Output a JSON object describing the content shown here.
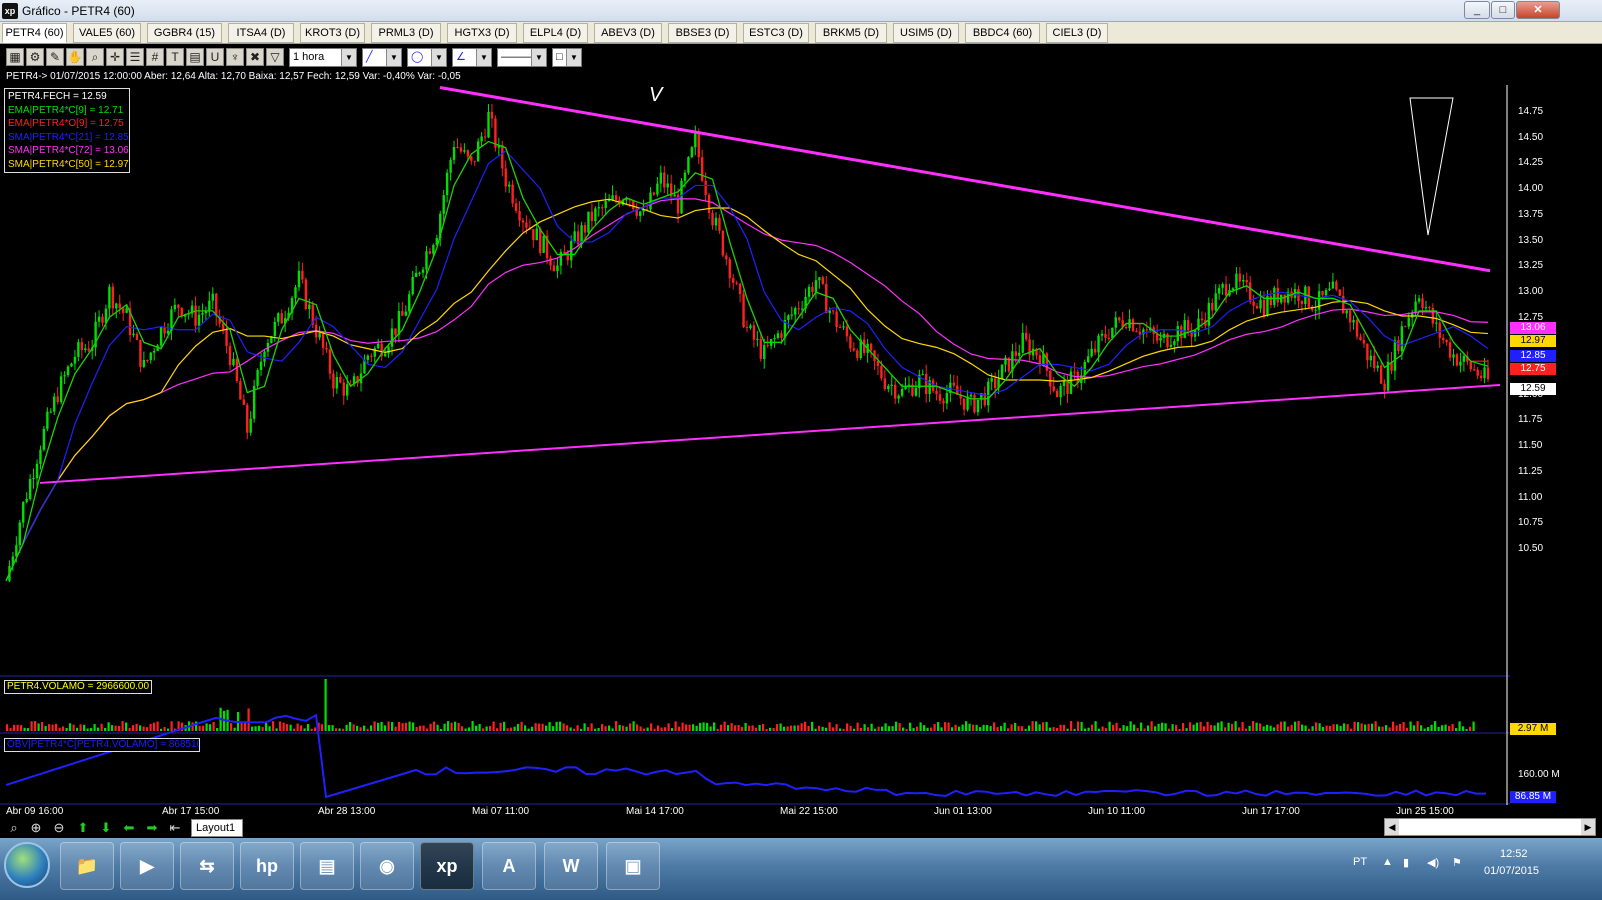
{
  "window": {
    "logo": "xp",
    "title": "Gráfico - PETR4 (60)",
    "minimize": "_",
    "maximize": "□",
    "close": "✕"
  },
  "tabs": [
    {
      "label": "PETR4 (60)",
      "active": true
    },
    {
      "label": "VALE5 (60)"
    },
    {
      "label": "GGBR4 (15)"
    },
    {
      "label": "ITSA4 (D)"
    },
    {
      "label": "KROT3 (D)"
    },
    {
      "label": "PRML3 (D)"
    },
    {
      "label": "HGTX3 (D)"
    },
    {
      "label": "ELPL4 (D)"
    },
    {
      "label": "ABEV3 (D)"
    },
    {
      "label": "BBSE3 (D)"
    },
    {
      "label": "ESTC3 (D)"
    },
    {
      "label": "BRKM5 (D)"
    },
    {
      "label": "USIM5 (D)"
    },
    {
      "label": "BBDC4 (60)"
    },
    {
      "label": "CIEL3 (D)"
    }
  ],
  "toolbar": {
    "icons": [
      "chart-type-icon",
      "settings-gear-icon",
      "draw-icon",
      "hand-pan-icon",
      "zoom-tool-icon",
      "crosshair-icon",
      "fibonacci-icon",
      "grid-icon",
      "text-tool-icon",
      "calculator-icon",
      "magnet-icon",
      "brush-icon",
      "trash-icon",
      "filter-icon"
    ],
    "periodicity": "1 hora"
  },
  "info_line": "PETR4-> 01/07/2015 12:00:00 Aber: 12,64 Alta: 12,70 Baixa: 12,57 Fech: 12,59 Var: -0,40% Var: -0,05",
  "legend": [
    {
      "text": "PETR4.FECH = 12.59",
      "color": "#ffffff"
    },
    {
      "text": "EMA|PETR4*C[9] = 12.71",
      "color": "#00e000"
    },
    {
      "text": "EMA|PETR4*O[9] = 12.75",
      "color": "#ff2020"
    },
    {
      "text": "SMA|PETR4*C[21] = 12.85",
      "color": "#2020ff"
    },
    {
      "text": "SMA|PETR4*C[72] = 13.06",
      "color": "#ff30ff"
    },
    {
      "text": "SMA|PETR4*C[50] = 12.97",
      "color": "#ffd800"
    }
  ],
  "price_axis": [
    "14.75",
    "14.50",
    "14.25",
    "14.00",
    "13.75",
    "13.50",
    "13.25",
    "13.00",
    "12.75",
    "12.50",
    "12.25",
    "12.00",
    "11.75",
    "11.50",
    "11.25",
    "11.00",
    "10.75",
    "10.50"
  ],
  "price_tags": [
    {
      "text": "13.06",
      "color": "#ff30ff",
      "fg": "#ffffff"
    },
    {
      "text": "12.97",
      "color": "#ffd800",
      "fg": "#000000"
    },
    {
      "text": "12.85",
      "color": "#2020ff",
      "fg": "#ffffff"
    },
    {
      "text": "12.75",
      "color": "#ff2020",
      "fg": "#ffffff"
    },
    {
      "text": "12.59",
      "color": "#ffffff",
      "fg": "#000000"
    }
  ],
  "volume": {
    "label": "PETR4.VOLAMO = 2966600.00",
    "tag": "2.97 M"
  },
  "obv": {
    "label": "OBV|PETR4*C[PETR4.VOLAMO] = 86851000.00",
    "axis_label": "160.00 M",
    "tag": "86.85 M"
  },
  "x_axis": [
    "Abr 09 16:00",
    "Abr 17 15:00",
    "Abr 28 13:00",
    "Mai 07 11:00",
    "Mai 14 17:00",
    "Mai 22 15:00",
    "Jun 01 13:00",
    "Jun 10 11:00",
    "Jun 17 17:00",
    "Jun 25 15:00"
  ],
  "annotations": {
    "peak_mark": "V"
  },
  "nav": {
    "icons": [
      "zoom-icon",
      "zoom-in-icon",
      "zoom-out-icon",
      "arrow-up-icon",
      "arrow-down-icon",
      "arrow-left-icon",
      "arrow-right-icon",
      "arrow-end-icon"
    ],
    "layout_tab": "Layout1"
  },
  "taskbar": {
    "apps": [
      "file-explorer-icon",
      "media-player-icon",
      "network-icon",
      "hp-icon",
      "scanner-icon",
      "chrome-icon",
      "xp-icon",
      "access-icon",
      "word-icon",
      "image-viewer-icon"
    ],
    "language": "PT",
    "time": "12:52",
    "date": "01/07/2015"
  },
  "chart_data": {
    "type": "line",
    "symbol": "PETR4",
    "timeframe": "60 min",
    "ylim": [
      10.25,
      14.95
    ],
    "close_series": [
      11.0,
      11.6,
      12.1,
      12.5,
      12.8,
      12.9,
      13.3,
      13.1,
      12.7,
      13.0,
      13.2,
      13.1,
      13.2,
      12.8,
      12.2,
      12.9,
      13.1,
      13.4,
      13.0,
      12.6,
      12.5,
      12.8,
      12.9,
      13.1,
      13.5,
      13.8,
      14.5,
      14.3,
      14.7,
      14.2,
      13.9,
      13.7,
      13.5,
      13.7,
      13.9,
      14.0,
      14.1,
      13.9,
      14.2,
      14.0,
      14.5,
      13.9,
      13.5,
      13.0,
      12.8,
      13.0,
      13.2,
      13.4,
      13.1,
      12.9,
      12.8,
      12.6,
      12.5,
      12.6,
      12.5,
      12.5,
      12.4,
      12.5,
      12.7,
      12.9,
      12.8,
      12.5,
      12.6,
      12.8,
      13.0,
      13.1,
      13.0,
      12.9,
      13.0,
      13.0,
      13.2,
      13.4,
      13.3,
      13.2,
      13.3,
      13.3,
      13.2,
      13.3,
      13.1,
      12.8,
      12.6,
      13.0,
      13.3,
      13.0,
      12.8,
      12.7,
      12.59
    ],
    "sma72_end": 13.06,
    "sma50_end": 12.97,
    "sma21_end": 12.85,
    "ema9o_end": 12.75,
    "ema9c_end": 12.71,
    "trendline_upper": [
      14.93,
      13.47
    ],
    "trendline_lower": [
      11.78,
      12.56
    ],
    "volume_current": 2966600
  }
}
